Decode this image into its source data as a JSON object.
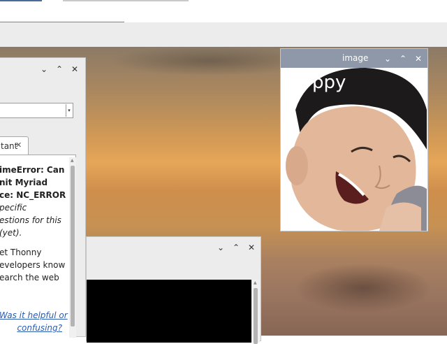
{
  "assistant_window": {
    "tab_label": "tant",
    "lines": [
      {
        "text": "imeError: Can",
        "style": "b"
      },
      {
        "text": "nit Myriad",
        "style": "b"
      },
      {
        "text": "ce: NC_ERROR",
        "style": "b"
      },
      {
        "text": "pecific",
        "style": "i"
      },
      {
        "text": "estions for this",
        "style": "i"
      },
      {
        "text": "(yet).",
        "style": "i"
      },
      {
        "text": "et Thonny",
        "style": ""
      },
      {
        "text": "evelopers know",
        "style": ""
      },
      {
        "text": "earch the web",
        "style": ""
      }
    ],
    "feedback_line1": "Was it helpful or",
    "feedback_line2": "confusing?"
  },
  "image_window": {
    "title": "image",
    "caption": "ppy"
  },
  "controls": {
    "minimize": "⌄",
    "maximize": "⌃",
    "close": "✕"
  },
  "colors": {
    "link": "#2a5cb0",
    "image_titlebar": "#8e98a8"
  }
}
